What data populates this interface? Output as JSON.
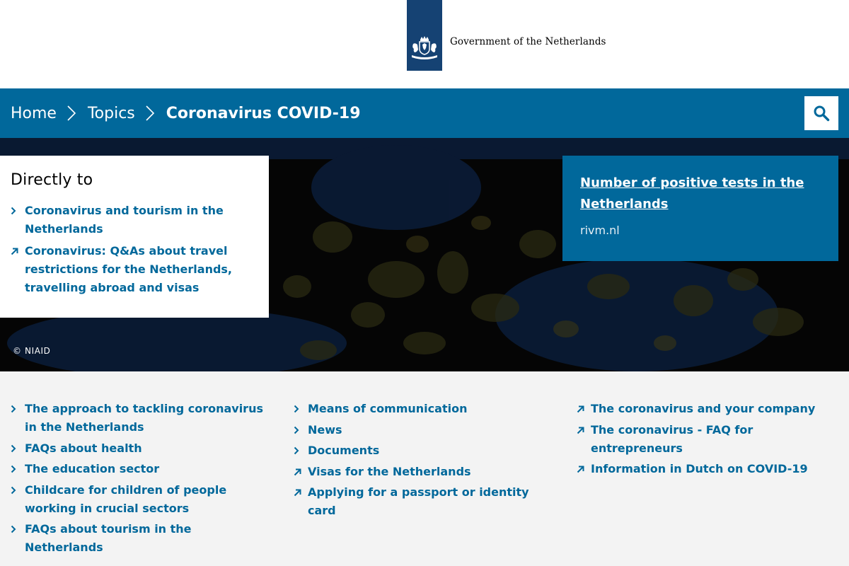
{
  "header": {
    "brand": "Government of the Netherlands"
  },
  "breadcrumb": {
    "items": [
      "Home",
      "Topics"
    ],
    "current": "Coronavirus COVID-19"
  },
  "search": {
    "icon": "search-icon"
  },
  "hero": {
    "directly_heading": "Directly to",
    "directly_links": [
      {
        "label": "Coronavirus and tourism in the Netherlands",
        "icon": "chevron-right-icon"
      },
      {
        "label": "Coronavirus: Q&As about travel restrictions for the Netherlands, travelling abroad and visas",
        "icon": "external-arrow-icon"
      }
    ],
    "stat": {
      "link": "Number of positive tests in the Netherlands",
      "source": "rivm.nl"
    },
    "credit": "©  NIAID"
  },
  "links": {
    "col1": [
      {
        "label": "The approach to tackling coronavirus in the Netherlands",
        "icon": "chevron-right-icon"
      },
      {
        "label": "FAQs about health",
        "icon": "chevron-right-icon"
      },
      {
        "label": "The education sector",
        "icon": "chevron-right-icon"
      },
      {
        "label": "Childcare for children of people working in crucial sectors",
        "icon": "chevron-right-icon"
      },
      {
        "label": "FAQs about tourism in the Netherlands",
        "icon": "chevron-right-icon"
      }
    ],
    "col2": [
      {
        "label": "Means of communication",
        "icon": "chevron-right-icon"
      },
      {
        "label": "News",
        "icon": "chevron-right-icon"
      },
      {
        "label": "Documents",
        "icon": "chevron-right-icon"
      },
      {
        "label": "Visas for the Netherlands",
        "icon": "external-arrow-icon"
      },
      {
        "label": "Applying for a passport or identity card",
        "icon": "external-arrow-icon"
      }
    ],
    "col3": [
      {
        "label": "The coronavirus and your company",
        "icon": "external-arrow-icon"
      },
      {
        "label": "The coronavirus - FAQ for entrepreneurs",
        "icon": "external-arrow-icon"
      },
      {
        "label": "Information in Dutch on COVID-19",
        "icon": "external-arrow-icon"
      }
    ]
  },
  "colors": {
    "brand_blue": "#154273",
    "bar_blue": "#01689b",
    "link_blue": "#01689b",
    "page_bg": "#f3f3f3"
  }
}
